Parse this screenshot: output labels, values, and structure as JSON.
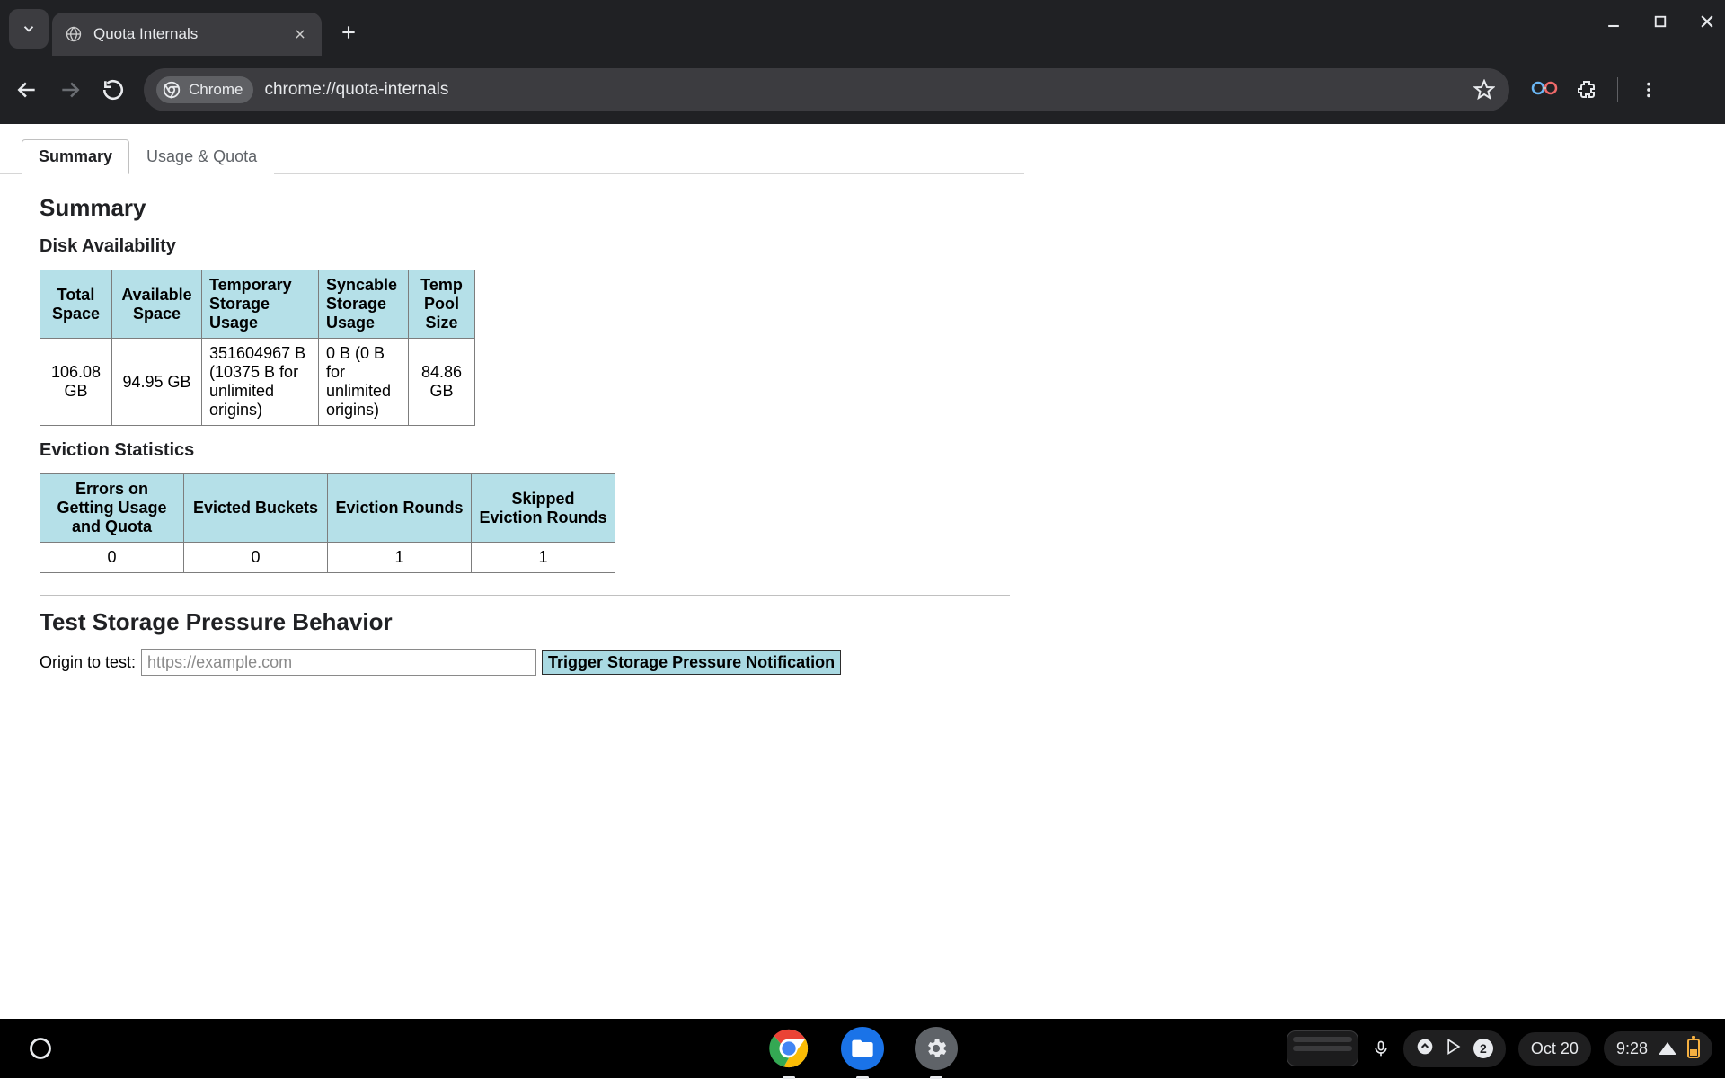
{
  "browser": {
    "tab_title": "Quota Internals",
    "omnibox_chip": "Chrome",
    "url": "chrome://quota-internals"
  },
  "page": {
    "tabs": {
      "active": "Summary",
      "inactive": "Usage & Quota"
    },
    "heading_summary": "Summary",
    "heading_disk": "Disk Availability",
    "disk_table": {
      "headers": [
        "Total Space",
        "Available Space",
        "Temporary Storage Usage",
        "Syncable Storage Usage",
        "Temp Pool Size"
      ],
      "row": [
        "106.08 GB",
        "94.95 GB",
        "351604967 B (10375 B for unlimited origins)",
        "0 B (0 B for unlimited origins)",
        "84.86 GB"
      ]
    },
    "heading_evict": "Eviction Statistics",
    "evict_table": {
      "headers": [
        "Errors on Getting Usage and Quota",
        "Evicted Buckets",
        "Eviction Rounds",
        "Skipped Eviction Rounds"
      ],
      "row": [
        "0",
        "0",
        "1",
        "1"
      ]
    },
    "heading_test": "Test Storage Pressure Behavior",
    "origin_label": "Origin to test:",
    "origin_placeholder": "https://example.com",
    "trigger_button": "Trigger Storage Pressure Notification"
  },
  "shelf": {
    "date": "Oct 20",
    "time": "9:28",
    "notif_count": "2"
  }
}
